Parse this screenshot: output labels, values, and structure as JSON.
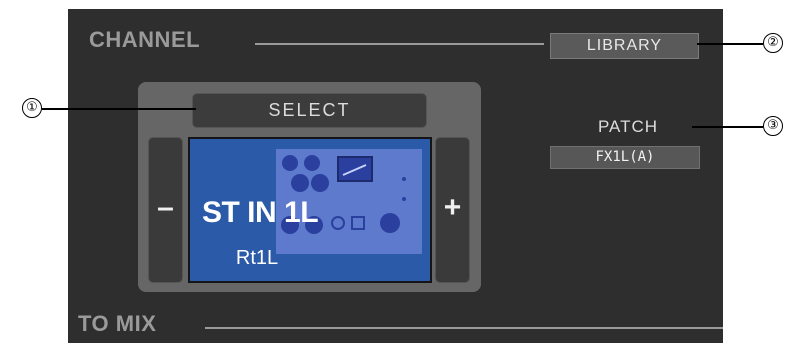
{
  "sections": {
    "channel_title": "CHANNEL",
    "to_mix_title": "TO MIX"
  },
  "buttons": {
    "library": "LIBRARY",
    "select": "SELECT",
    "minus": "–",
    "plus": "+"
  },
  "patch": {
    "label": "PATCH",
    "value": "FX1L(A)"
  },
  "channel_display": {
    "name": "ST IN 1L",
    "sub_name": "Rt1L",
    "icon": "effect-rack-graphic"
  },
  "callouts": [
    "①",
    "②",
    "③"
  ],
  "colors": {
    "panel_bg": "#2e2e2e",
    "screen_blue": "#2a5aa8",
    "title_gray": "#9a9a9a"
  }
}
